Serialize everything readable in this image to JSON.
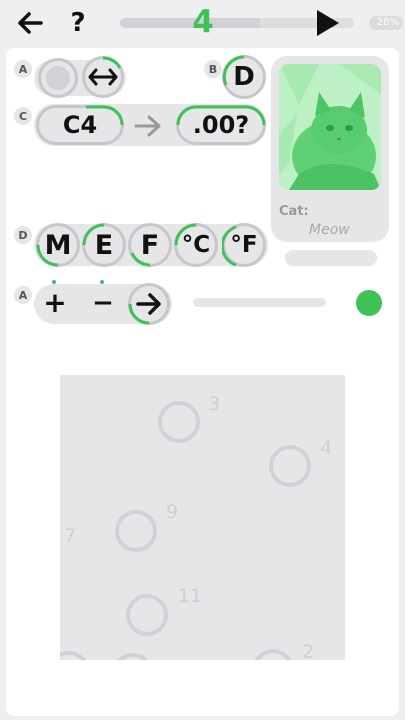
{
  "header": {
    "back_icon": "arrow-left-icon",
    "help_label": "?",
    "level": "4",
    "level_progress": 0.6,
    "play_icon": "play-icon",
    "percent": "28%"
  },
  "rows": {
    "a1": {
      "tag": "A",
      "swap_icon": "double-arrow-icon"
    },
    "b": {
      "tag": "B",
      "label": "D"
    },
    "c": {
      "tag": "C",
      "from": "C4",
      "arrow_icon": "arrow-right-icon",
      "to": ".00?"
    },
    "d": {
      "tag": "D",
      "options": [
        "M",
        "E",
        "F",
        "°C",
        "°F"
      ]
    },
    "a2": {
      "tag": "A",
      "plus": "+",
      "minus": "−",
      "go_icon": "arrow-right-icon",
      "slider_value": 0.0
    }
  },
  "card": {
    "name": "Cat:",
    "sound": "Meow",
    "image": "cat-photo"
  },
  "field": {
    "targets": [
      {
        "label": "3"
      },
      {
        "label": "4"
      },
      {
        "label": "9"
      },
      {
        "label": "7"
      },
      {
        "label": "11"
      },
      {
        "label": "2"
      }
    ]
  },
  "colors": {
    "accent": "#3ec257",
    "panel": "#ffffff",
    "background": "#efeff1",
    "control": "#e6e6e9"
  }
}
